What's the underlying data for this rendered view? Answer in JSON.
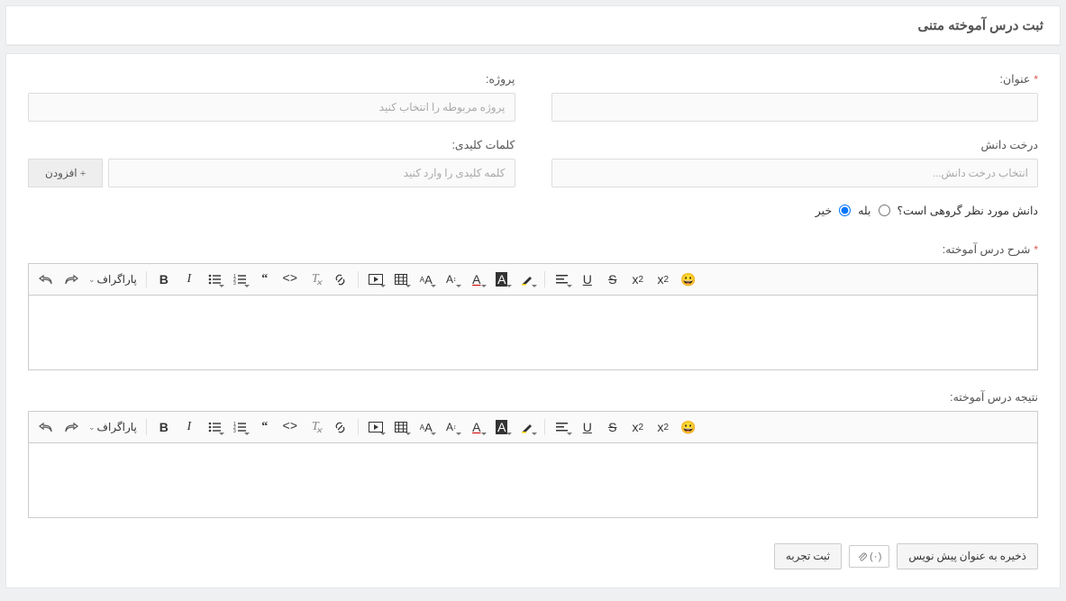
{
  "page_title": "ثبت درس آموخته متنی",
  "fields": {
    "title_label": "عنوان:",
    "project_label": "پروژه:",
    "project_placeholder": "پروژه مربوطه را انتخاب کنید",
    "tree_label": "درخت دانش",
    "tree_placeholder": "انتخاب درخت دانش...",
    "keywords_label": "کلمات کلیدی:",
    "keywords_placeholder": "کلمه کلیدی را وارد کنید",
    "add_button": "+ افزودن",
    "group_question": "دانش مورد نظر گروهی است؟",
    "yes": "بله",
    "no": "خیر",
    "no_checked": true
  },
  "sections": {
    "description_label": "شرح درس آموخته:",
    "result_label": "نتیجه درس آموخته:"
  },
  "toolbar": {
    "paragraph": "پاراگراف",
    "undo": "undo-icon",
    "redo": "redo-icon"
  },
  "footer": {
    "save_draft": "ذخیره به عنوان پیش نویس",
    "attach_count": "(۰)",
    "submit": "ثبت تجربه"
  }
}
